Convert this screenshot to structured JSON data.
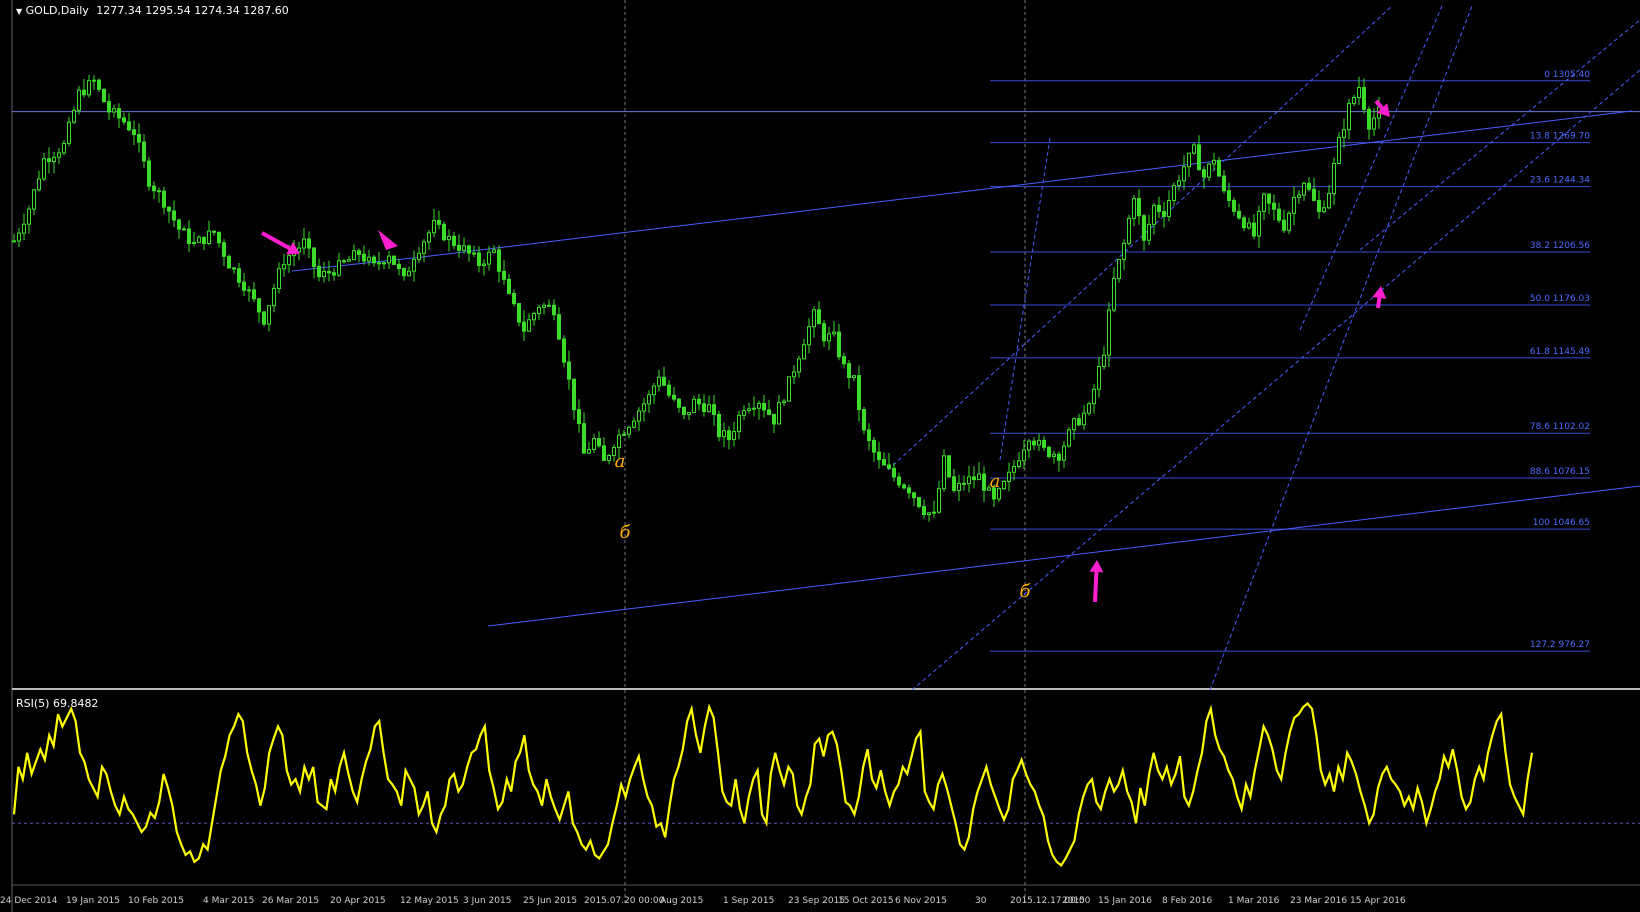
{
  "header": {
    "symbol": "GOLD,Daily",
    "ohlc": "1277.34 1295.54 1274.34 1287.60",
    "rsi_label": "RSI(5) 69.8482"
  },
  "colors": {
    "background": "#000000",
    "candles": "#3ddc2a",
    "fib_lines": "#3b4cd6",
    "trendlines": "#4a5cff",
    "rsi_line": "#ffff00",
    "arrows": "#ff1fd0",
    "wave_labels": "#ffb000",
    "separator": "#bbbbbb"
  },
  "wave_labels": [
    "a",
    "б",
    "a",
    "б"
  ],
  "chart_data": [
    {
      "type": "candlestick",
      "symbol": "GOLD",
      "timeframe": "Daily",
      "y_range": [
        950,
        1340
      ],
      "x_tick_labels": [
        "24 Dec 2014",
        "19 Jan 2015",
        "10 Feb 2015",
        "4 Mar 2015",
        "26 Mar 2015",
        "20 Apr 2015",
        "12 May 2015",
        "3 Jun 2015",
        "25 Jun 2015",
        "2015.07.20 00:00",
        "Aug 2015",
        "1 Sep 2015",
        "23 Sep 2015",
        "15 Oct 2015",
        "6 Nov 2015",
        "30",
        "2015.12.17 00:00",
        "2015",
        "15 Jan 2016",
        "8 Feb 2016",
        "1 Mar 2016",
        "23 Mar 2016",
        "15 Apr 2016"
      ],
      "close_path": [
        [
          0,
          1213
        ],
        [
          3,
          1232
        ],
        [
          6,
          1260
        ],
        [
          10,
          1268
        ],
        [
          13,
          1298
        ],
        [
          16,
          1305
        ],
        [
          19,
          1288
        ],
        [
          22,
          1282
        ],
        [
          24,
          1276
        ],
        [
          27,
          1248
        ],
        [
          30,
          1236
        ],
        [
          33,
          1220
        ],
        [
          36,
          1211
        ],
        [
          40,
          1218
        ],
        [
          43,
          1200
        ],
        [
          46,
          1188
        ],
        [
          50,
          1168
        ],
        [
          52,
          1186
        ],
        [
          54,
          1202
        ],
        [
          58,
          1212
        ],
        [
          61,
          1192
        ],
        [
          65,
          1198
        ],
        [
          69,
          1206
        ],
        [
          72,
          1198
        ],
        [
          75,
          1206
        ],
        [
          78,
          1190
        ],
        [
          80,
          1205
        ],
        [
          84,
          1222
        ],
        [
          87,
          1214
        ],
        [
          90,
          1208
        ],
        [
          93,
          1200
        ],
        [
          96,
          1207
        ],
        [
          99,
          1180
        ],
        [
          102,
          1162
        ],
        [
          105,
          1176
        ],
        [
          108,
          1174
        ],
        [
          111,
          1132
        ],
        [
          114,
          1090
        ],
        [
          116,
          1098
        ],
        [
          118,
          1085
        ],
        [
          120,
          1097
        ],
        [
          123,
          1108
        ],
        [
          127,
          1123
        ],
        [
          129,
          1136
        ],
        [
          131,
          1124
        ],
        [
          134,
          1111
        ],
        [
          136,
          1120
        ],
        [
          139,
          1117
        ],
        [
          141,
          1102
        ],
        [
          143,
          1099
        ],
        [
          146,
          1118
        ],
        [
          149,
          1121
        ],
        [
          152,
          1110
        ],
        [
          155,
          1131
        ],
        [
          158,
          1156
        ],
        [
          160,
          1170
        ],
        [
          162,
          1158
        ],
        [
          164,
          1157
        ],
        [
          166,
          1140
        ],
        [
          168,
          1132
        ],
        [
          170,
          1102
        ],
        [
          173,
          1085
        ],
        [
          176,
          1077
        ],
        [
          179,
          1070
        ],
        [
          182,
          1058
        ],
        [
          184,
          1054
        ],
        [
          186,
          1086
        ],
        [
          188,
          1068
        ],
        [
          190,
          1074
        ],
        [
          193,
          1077
        ],
        [
          196,
          1062
        ],
        [
          199,
          1077
        ],
        [
          203,
          1101
        ],
        [
          206,
          1092
        ],
        [
          209,
          1090
        ],
        [
          212,
          1107
        ],
        [
          215,
          1116
        ],
        [
          218,
          1150
        ],
        [
          220,
          1190
        ],
        [
          222,
          1211
        ],
        [
          224,
          1240
        ],
        [
          226,
          1212
        ],
        [
          228,
          1233
        ],
        [
          230,
          1230
        ],
        [
          232,
          1244
        ],
        [
          234,
          1256
        ],
        [
          236,
          1265
        ],
        [
          238,
          1250
        ],
        [
          240,
          1261
        ],
        [
          242,
          1240
        ],
        [
          244,
          1232
        ],
        [
          246,
          1224
        ],
        [
          248,
          1216
        ],
        [
          250,
          1237
        ],
        [
          252,
          1230
        ],
        [
          254,
          1222
        ],
        [
          256,
          1238
        ],
        [
          258,
          1248
        ],
        [
          261,
          1229
        ],
        [
          263,
          1242
        ],
        [
          265,
          1270
        ],
        [
          267,
          1290
        ],
        [
          269,
          1302
        ],
        [
          271,
          1281
        ],
        [
          273,
          1287
        ]
      ],
      "last_bar": {
        "open": 1277.34,
        "high": 1295.54,
        "low": 1274.34,
        "close": 1287.6
      },
      "fibonacci_levels": [
        {
          "level": "0",
          "price": 1305.4
        },
        {
          "level": "13.8",
          "price": 1269.7
        },
        {
          "level": "23.6",
          "price": 1244.34
        },
        {
          "level": "38.2",
          "price": 1206.56
        },
        {
          "level": "50.0",
          "price": 1176.03
        },
        {
          "level": "61.8",
          "price": 1145.49
        },
        {
          "level": "78.6",
          "price": 1102.02
        },
        {
          "level": "88.6",
          "price": 1076.15
        },
        {
          "level": "100",
          "price": 1046.65
        },
        {
          "level": "127.2",
          "price": 976.27
        }
      ]
    },
    {
      "type": "line",
      "name": "RSI(5)",
      "last_value": 69.8482,
      "y_range": [
        0,
        100
      ],
      "reference_level": 30,
      "values": [
        35,
        62,
        55,
        70,
        58,
        65,
        72,
        66,
        80,
        74,
        92,
        85,
        90,
        95,
        88,
        70,
        65,
        55,
        50,
        45,
        62,
        58,
        48,
        40,
        35,
        45,
        38,
        35,
        30,
        25,
        28,
        36,
        33,
        42,
        58,
        50,
        40,
        25,
        18,
        12,
        14,
        8,
        10,
        18,
        15,
        30,
        45,
        60,
        68,
        80,
        85,
        92,
        88,
        70,
        60,
        52,
        40,
        50,
        70,
        78,
        85,
        80,
        60,
        52,
        55,
        48,
        62,
        55,
        62,
        42,
        40,
        38,
        55,
        48,
        62,
        70,
        58,
        48,
        42,
        55,
        65,
        72,
        85,
        88,
        70,
        55,
        52,
        48,
        40,
        60,
        55,
        50,
        35,
        40,
        48,
        30,
        25,
        35,
        40,
        55,
        58,
        48,
        52,
        62,
        70,
        72,
        80,
        85,
        60,
        50,
        38,
        42,
        55,
        48,
        65,
        70,
        80,
        60,
        52,
        48,
        40,
        55,
        45,
        38,
        32,
        40,
        48,
        30,
        25,
        18,
        15,
        20,
        12,
        10,
        14,
        18,
        30,
        40,
        52,
        45,
        55,
        62,
        68,
        55,
        45,
        40,
        28,
        30,
        22,
        40,
        55,
        62,
        72,
        88,
        95,
        80,
        70,
        85,
        96,
        90,
        70,
        48,
        42,
        40,
        55,
        38,
        30,
        45,
        55,
        60,
        35,
        30,
        58,
        70,
        60,
        52,
        62,
        58,
        40,
        35,
        45,
        52,
        75,
        78,
        68,
        80,
        82,
        75,
        60,
        42,
        40,
        35,
        45,
        62,
        72,
        55,
        50,
        60,
        48,
        40,
        48,
        52,
        62,
        58,
        68,
        78,
        82,
        48,
        42,
        38,
        52,
        58,
        50,
        40,
        30,
        18,
        15,
        22,
        38,
        48,
        55,
        62,
        52,
        45,
        38,
        32,
        38,
        55,
        60,
        66,
        58,
        52,
        48,
        40,
        34,
        20,
        12,
        8,
        6,
        10,
        15,
        20,
        35,
        45,
        52,
        55,
        42,
        38,
        48,
        55,
        48,
        52,
        60,
        48,
        42,
        30,
        50,
        40,
        58,
        70,
        60,
        55,
        62,
        52,
        58,
        68,
        45,
        40,
        48,
        60,
        70,
        88,
        95,
        80,
        72,
        68,
        60,
        55,
        45,
        38,
        52,
        45,
        60,
        72,
        85,
        80,
        72,
        60,
        55,
        70,
        82,
        90,
        92,
        96,
        98,
        95,
        80,
        60,
        52,
        58,
        48,
        62,
        55,
        70,
        65,
        58,
        48,
        40,
        30,
        35,
        50,
        58,
        62,
        55,
        52,
        48,
        40,
        45,
        38,
        50,
        42,
        30,
        38,
        48,
        55,
        68,
        62,
        72,
        60,
        45,
        38,
        42,
        55,
        62,
        55,
        70,
        80,
        88,
        92,
        70,
        52,
        45,
        40,
        35,
        55,
        70
      ]
    }
  ]
}
